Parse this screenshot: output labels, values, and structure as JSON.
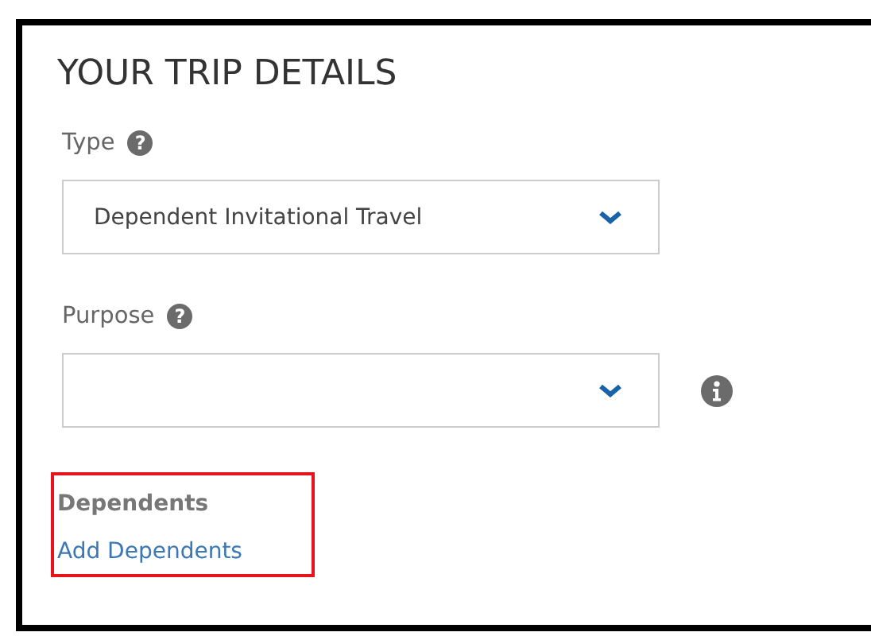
{
  "title": "YOUR TRIP DETAILS",
  "fields": [
    {
      "label": "Type",
      "help": "?",
      "value": "Dependent Invitational Travel",
      "info": false
    },
    {
      "label": "Purpose",
      "help": "?",
      "info": true
    }
  ],
  "dependents": {
    "label": "Dependents",
    "link": "Add Dependents",
    "highlighted": true
  }
}
